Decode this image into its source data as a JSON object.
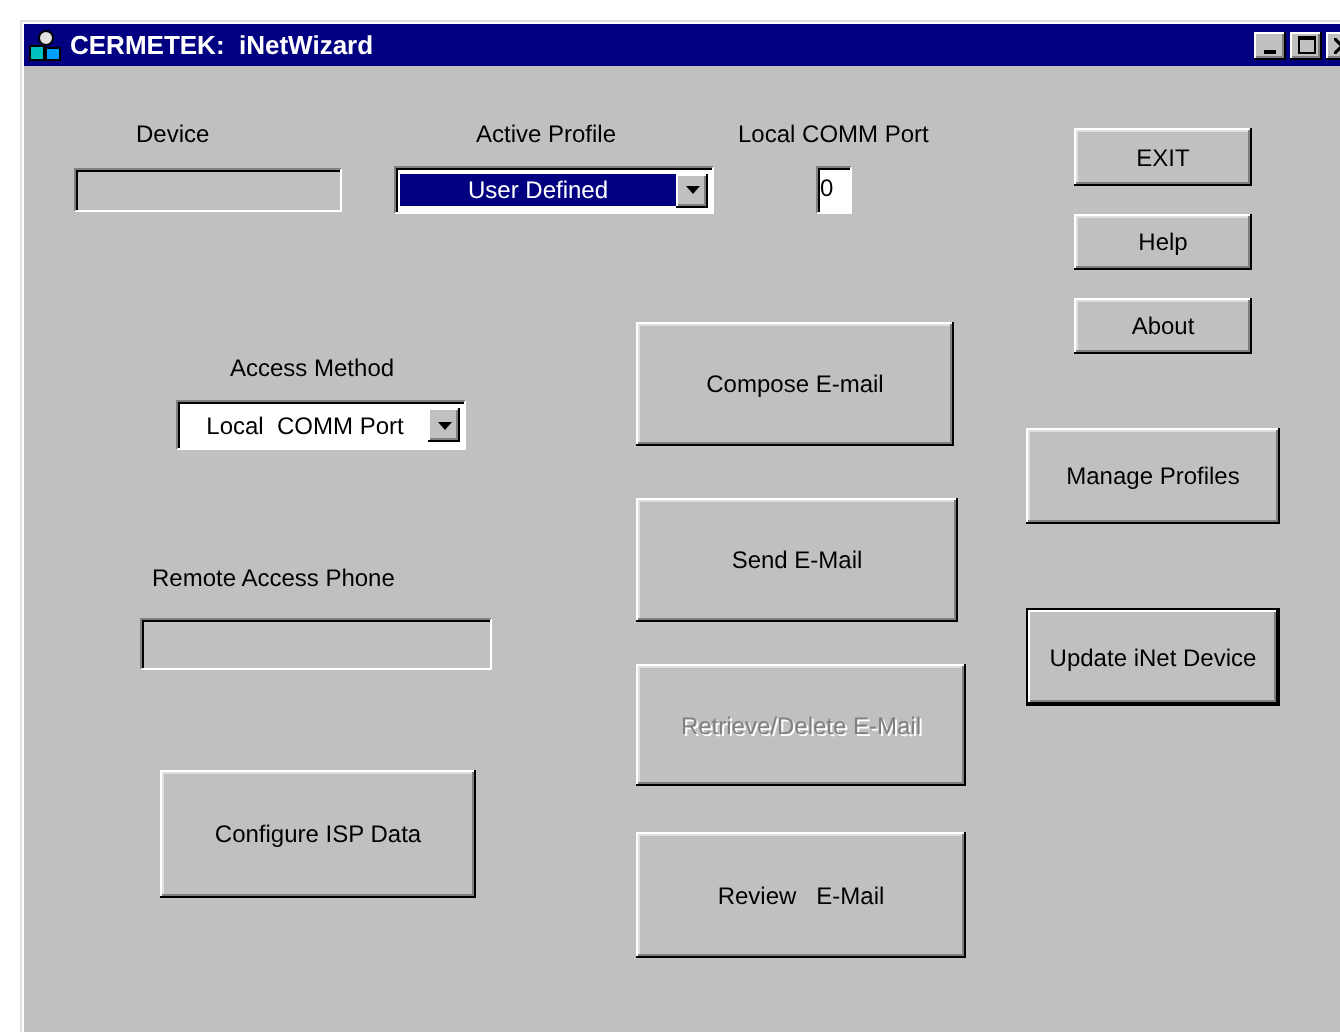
{
  "window": {
    "title": "CERMETEK:  iNetWizard"
  },
  "controls": [
    {
      "kind": "label",
      "text": "Device"
    },
    {
      "kind": "field",
      "disabled": true
    },
    {
      "kind": "label",
      "text": "Active Profile"
    },
    {
      "kind": "combo",
      "value": "User Defined",
      "focused": true
    },
    {
      "kind": "label",
      "text": "Local COMM Port"
    },
    {
      "kind": "field",
      "disabled": false,
      "value": "0"
    },
    {
      "kind": "button",
      "label": "EXIT",
      "disabled": false,
      "default": false
    },
    {
      "kind": "button",
      "label": "Help",
      "disabled": false,
      "default": false
    },
    {
      "kind": "button",
      "label": "About",
      "disabled": false,
      "default": false
    },
    {
      "kind": "label",
      "text": "Access Method"
    },
    {
      "kind": "combo",
      "value": "Local  COMM Port",
      "focused": false
    },
    {
      "kind": "button",
      "label": "Compose E-mail",
      "disabled": false,
      "default": false
    },
    {
      "kind": "button",
      "label": "Manage Profiles",
      "disabled": false,
      "default": false
    },
    {
      "kind": "button",
      "label": "Send E-Mail",
      "disabled": false,
      "default": false
    },
    {
      "kind": "label",
      "text": "Remote Access Phone"
    },
    {
      "kind": "field",
      "disabled": true
    },
    {
      "kind": "button",
      "label": "Update iNet Device",
      "disabled": false,
      "default": true
    },
    {
      "kind": "button",
      "label": "Retrieve/Delete E-Mail",
      "disabled": true,
      "default": false
    },
    {
      "kind": "button",
      "label": "Configure ISP Data",
      "disabled": false,
      "default": false
    },
    {
      "kind": "button",
      "label": "Review   E-Mail",
      "disabled": false,
      "default": false
    }
  ]
}
